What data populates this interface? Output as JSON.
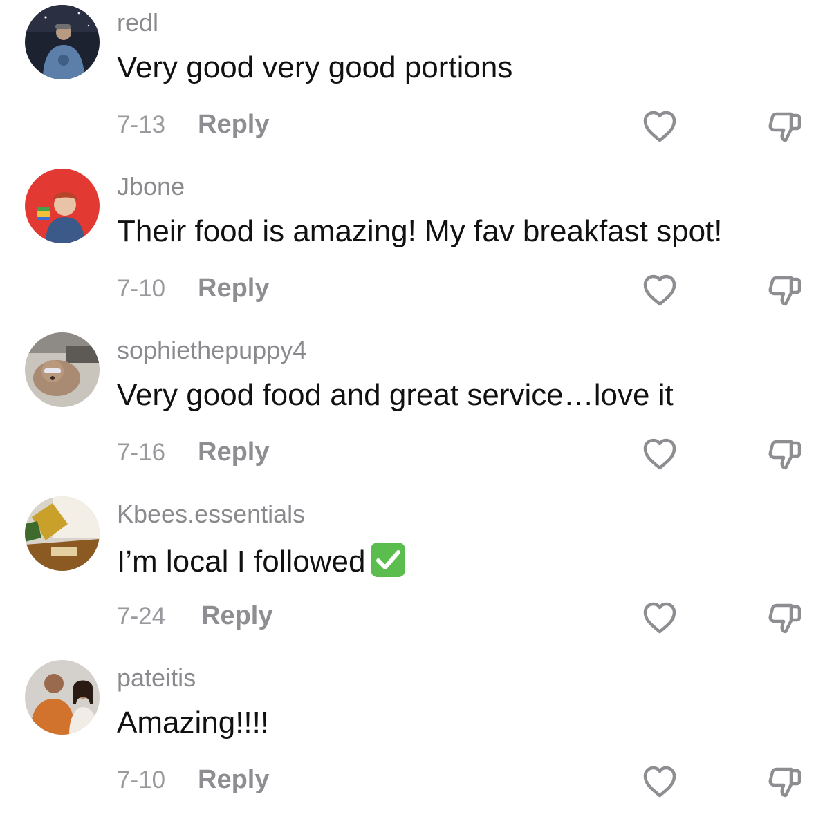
{
  "comments": [
    {
      "username": "redl",
      "text": "Very good very good portions",
      "date": "7-13",
      "reply_label": "Reply",
      "avatar_icon": "user-photo-man-cap"
    },
    {
      "username": "Jbone",
      "text": "Their food is amazing! My fav breakfast spot!",
      "date": "7-10",
      "reply_label": "Reply",
      "avatar_icon": "user-photo-doll-red-background"
    },
    {
      "username": "sophiethepuppy4",
      "text": "Very good food and great service…love it",
      "date": "7-16",
      "reply_label": "Reply",
      "avatar_icon": "user-photo-dog"
    },
    {
      "username": "Kbees.essentials",
      "text": "I’m local I followed",
      "emoji": "white-check-mark-button",
      "date": "7-24",
      "reply_label": "Reply",
      "avatar_icon": "user-photo-honey-pot"
    },
    {
      "username": "pateitis",
      "text": "Amazing!!!!",
      "date": "7-10",
      "reply_label": "Reply",
      "avatar_icon": "user-photo-couple"
    }
  ],
  "colors": {
    "username": "#8a8a8e",
    "text": "#111111",
    "meta": "#9a9a9e",
    "icon_stroke": "#8d8d92",
    "check_green": "#5bbd4e"
  }
}
